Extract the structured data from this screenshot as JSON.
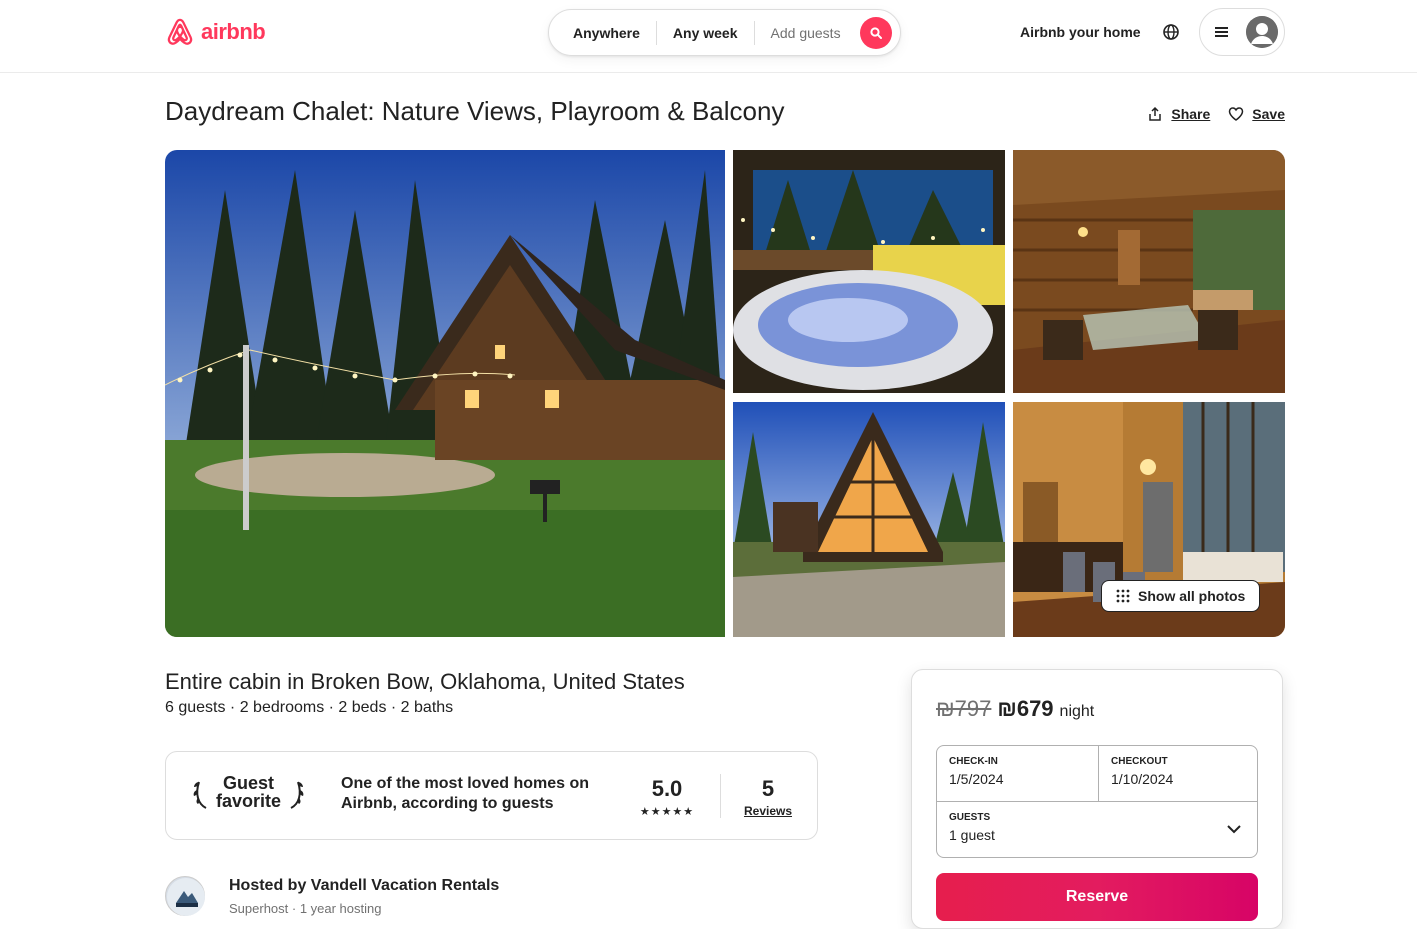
{
  "brand": {
    "name": "airbnb",
    "color": "#ff385c"
  },
  "search": {
    "where": "Anywhere",
    "when": "Any week",
    "who": "Add guests"
  },
  "header": {
    "host_link": "Airbnb your home",
    "globe_icon": "globe-icon",
    "menu_icon": "hamburger-icon"
  },
  "listing": {
    "title": "Daydream Chalet: Nature Views, Playroom & Balcony",
    "share_label": "Share",
    "save_label": "Save",
    "show_all_photos": "Show all photos",
    "subtitle": "Entire cabin in Broken Bow, Oklahoma, United States",
    "specs": "6 guests · 2 bedrooms · 2 beds · 2 baths",
    "photos": [
      {
        "name": "cabin-exterior-dusk"
      },
      {
        "name": "hot-tub-porch"
      },
      {
        "name": "covered-porch-dining"
      },
      {
        "name": "a-frame-exterior"
      },
      {
        "name": "living-room-interior"
      }
    ]
  },
  "guest_favorite": {
    "line1": "Guest",
    "line2": "favorite",
    "description": "One of the most loved homes on Airbnb, according to guests",
    "rating": "5.0",
    "stars": "★★★★★",
    "reviews_count": "5",
    "reviews_label": "Reviews"
  },
  "host": {
    "name": "Hosted by Vandell Vacation Rentals",
    "meta": "Superhost · 1 year hosting"
  },
  "booking": {
    "old_price": "₪797",
    "new_price": "₪679",
    "unit": "night",
    "checkin_label": "CHECK-IN",
    "checkin_value": "1/5/2024",
    "checkout_label": "CHECKOUT",
    "checkout_value": "1/10/2024",
    "guests_label": "GUESTS",
    "guests_value": "1 guest",
    "reserve_label": "Reserve"
  }
}
